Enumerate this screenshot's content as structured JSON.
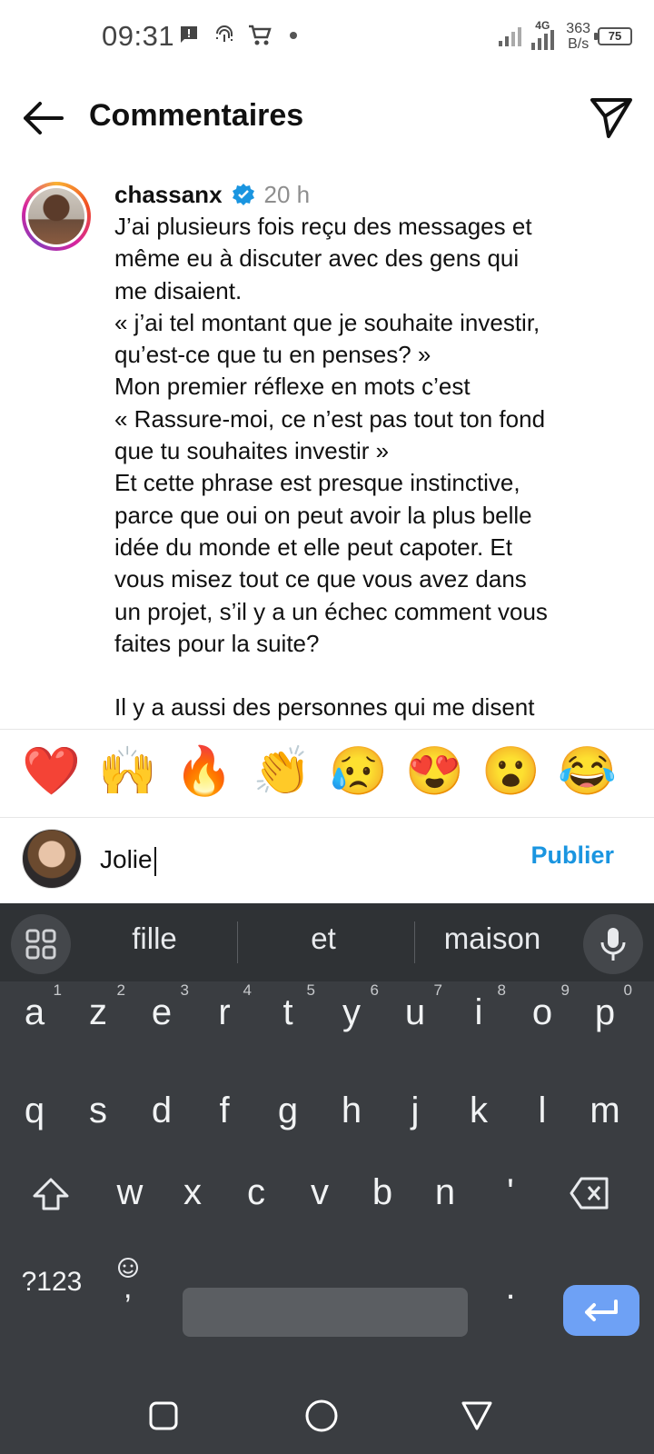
{
  "status_bar": {
    "time": "09:31",
    "net_type": "4G",
    "speed_value": "363",
    "speed_unit": "B/s",
    "battery": "75",
    "icons": [
      "message-icon",
      "fingerprint-icon",
      "cart-icon",
      "dot-icon",
      "signal-icon",
      "wifi-signal-icon",
      "battery-icon"
    ]
  },
  "header": {
    "title": "Commentaires",
    "back_icon": "arrow-left-icon",
    "share_icon": "send-icon"
  },
  "comment": {
    "username": "chassanx",
    "verified": true,
    "time_ago": "20 h",
    "lines": [
      "J’ai plusieurs fois reçu des messages et",
      "même eu à discuter avec des gens qui",
      "me disaient.",
      "« j’ai tel montant que je souhaite investir,",
      "qu’est-ce que tu en penses? »",
      "Mon premier réflexe en mots c’est",
      "« Rassure-moi, ce n’est pas tout ton fond",
      "que tu souhaites investir »",
      "Et cette phrase est presque instinctive,",
      "parce que oui on peut avoir la plus belle",
      "idée du monde et elle peut capoter. Et",
      "vous misez tout ce que vous avez dans",
      "un projet, s’il y a un échec comment vous",
      "faites pour la suite?",
      "",
      "Il y a aussi des personnes qui me disent"
    ]
  },
  "reactions": [
    "❤️",
    "🙌",
    "🔥",
    "👏",
    "😥",
    "😍",
    "😮",
    "😂"
  ],
  "input": {
    "value": "Jolie",
    "publish_label": "Publier"
  },
  "keyboard": {
    "suggestions": [
      "fille",
      "et",
      "maison"
    ],
    "row1": [
      "a",
      "z",
      "e",
      "r",
      "t",
      "y",
      "u",
      "i",
      "o",
      "p"
    ],
    "row1_hints": [
      "1",
      "2",
      "3",
      "4",
      "5",
      "6",
      "7",
      "8",
      "9",
      "0"
    ],
    "row2": [
      "q",
      "s",
      "d",
      "f",
      "g",
      "h",
      "j",
      "k",
      "l",
      "m"
    ],
    "row3": [
      "w",
      "x",
      "c",
      "v",
      "b",
      "n",
      "'"
    ],
    "symbols_label": "?123",
    "comma": ",",
    "period": "."
  },
  "colors": {
    "accent": "#1a95e0",
    "keyboard_bg": "#3a3d41",
    "enter_key": "#6ea1f5"
  }
}
